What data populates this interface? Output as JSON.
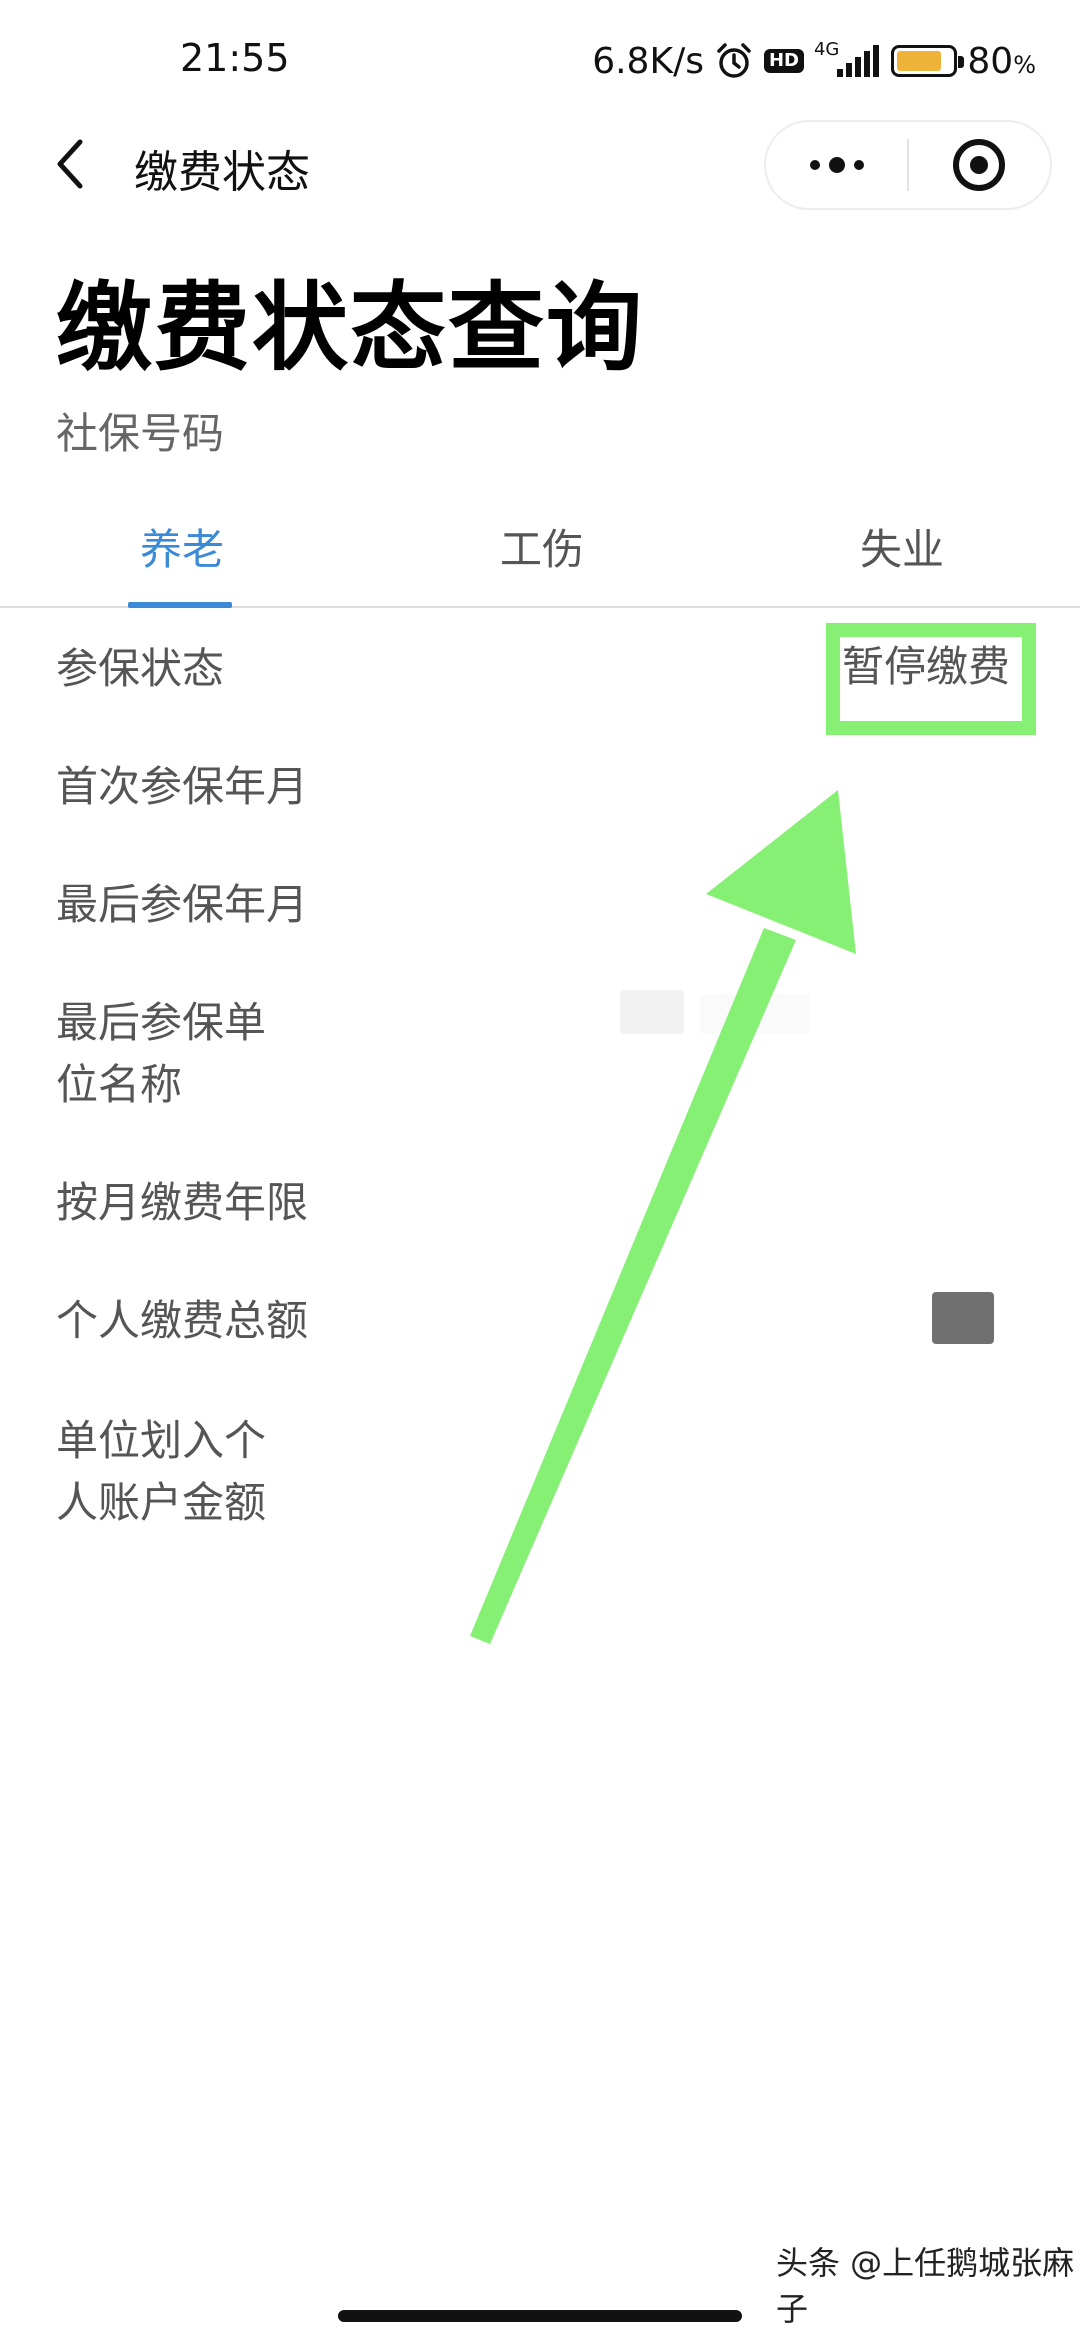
{
  "status_bar": {
    "time": "21:55",
    "net_speed": "6.8K/s",
    "hd_badge": "HD",
    "network_type": "4G",
    "battery_level": 80,
    "battery_pct": "80",
    "battery_unit": "%",
    "icons": [
      "alarm-icon",
      "hd-icon",
      "signal-icon",
      "battery-icon"
    ]
  },
  "nav": {
    "title": "缴费状态",
    "back_icon": "chevron-left-icon",
    "more_icon": "more-dots-icon",
    "close_icon": "target-circle-icon"
  },
  "page": {
    "title": "缴费状态查询",
    "subtitle": "社保号码"
  },
  "tabs": [
    {
      "label": "养老",
      "active": true
    },
    {
      "label": "工伤",
      "active": false
    },
    {
      "label": "失业",
      "active": false
    }
  ],
  "rows": [
    {
      "label": "参保状态",
      "value": "暂停缴费"
    },
    {
      "label": "首次参保年月",
      "value": ""
    },
    {
      "label": "最后参保年月",
      "value": ""
    },
    {
      "label": "最后参保单位名称",
      "value": ""
    },
    {
      "label": "按月缴费年限",
      "value": ""
    },
    {
      "label": "个人缴费总额",
      "value": ""
    },
    {
      "label": "单位划入个人账户金额",
      "value": ""
    }
  ],
  "annotation": {
    "arrow_color": "#86f075",
    "box_color": "#86f075"
  },
  "watermark": "头条 @上任鹅城张麻子",
  "colors": {
    "accent": "#3a8ad6",
    "battery": "#f0b33a"
  }
}
